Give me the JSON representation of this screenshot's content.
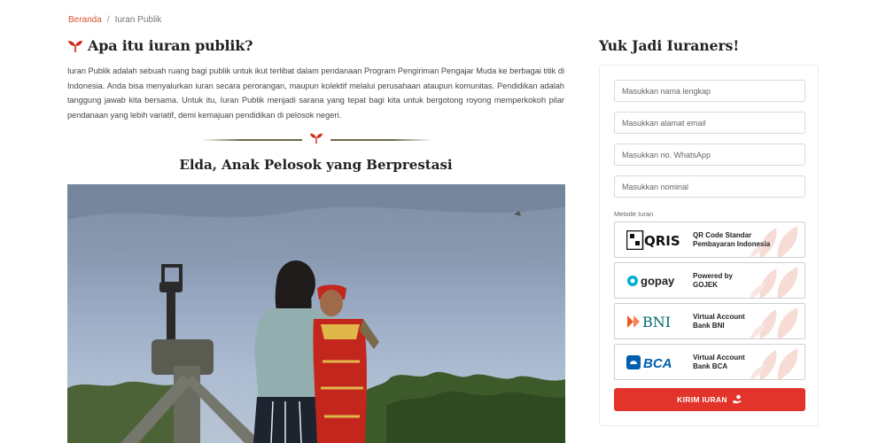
{
  "breadcrumb": {
    "home": "Beranda",
    "separator": "/",
    "current": "Iuran Publik"
  },
  "article": {
    "title": "Apa itu iuran publik?",
    "paragraphs": [
      "Iuran Publik adalah sebuah ruang bagi publik untuk ikut terlibat dalam pendanaan Program Pengiriman Pengajar Muda ke berbagai titik di Indonesia. Anda bisa menyalurkan iuran secara perorangan, maupun kolektif melalui perusahaan ataupun komunitas. Pendidikan adalah tanggung jawab kita bersama. Untuk itu, Iuran Publik menjadi sarana yang tepat bagi kita untuk bergotong royong memperkokoh pilar pendanaan yang lebih variatif, demi kemajuan pendidikan di pelosok negeri."
    ],
    "story_title": "Elda, Anak Pelosok yang Berprestasi"
  },
  "form": {
    "heading": "Yuk Jadi Iuraners!",
    "fields": {
      "name_placeholder": "Masukkan nama lengkap",
      "email_placeholder": "Masukkan alamat email",
      "whatsapp_placeholder": "Masukkan no. WhatsApp",
      "amount_placeholder": "Masukkan nominal"
    },
    "method_label": "Metode Iuran",
    "methods": [
      {
        "logo": "QRIS",
        "line1": "QR Code Standar",
        "line2": "Pembayaran Indonesia"
      },
      {
        "logo": "gopay",
        "line1": "Powered by",
        "line2": "GOJEK"
      },
      {
        "logo": "BNI",
        "line1": "Virtual Account",
        "line2": "Bank BNI"
      },
      {
        "logo": "BCA",
        "line1": "Virtual Account",
        "line2": "Bank BCA"
      }
    ],
    "submit_label": "KIRIM IURAN"
  },
  "icons": {
    "title": "sprout-icon",
    "divider": "sprout-icon",
    "submit": "hand-coin-icon",
    "payment_decor": "leaf-icon"
  },
  "colors": {
    "accent": "#e2342b",
    "breadcrumb_link": "#d9522c",
    "qris_bg": "#ffffff",
    "gopay_blue": "#00aed6",
    "bni_orange": "#f15a23",
    "bni_teal": "#006a72",
    "bca_blue": "#0060af"
  }
}
